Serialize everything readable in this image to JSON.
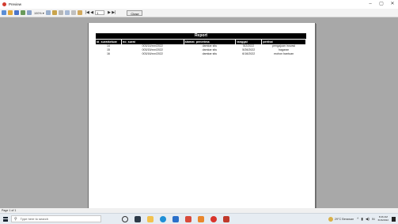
{
  "window": {
    "title": "Preview",
    "controls": {
      "minimize": "–",
      "maximize": "▢",
      "close": "✕"
    }
  },
  "toolbar": {
    "zoom": "100% ▾",
    "page_value": "1",
    "nav_prev": "|◀ ◀",
    "nav_next": "▶ ▶|",
    "close_label": "Close"
  },
  "report": {
    "title": "Report",
    "columns": [
      "id_suratkeluar",
      "no_surat",
      "alamat_penerima",
      "tanggal",
      "perihal"
    ],
    "rows": [
      [
        "14",
        "003/14/xxx/2022",
        "damkar situ",
        "5/2/2022",
        "pengajuan inovasi"
      ],
      [
        "15",
        "003/15/xxx/2022",
        "damkar situ",
        "5/26/2022",
        "hagaran"
      ],
      [
        "16",
        "003/16/xxx/2022",
        "damkar situ",
        "6/16/2022",
        "mohon bantuan"
      ]
    ]
  },
  "status": {
    "page_info": "Page 1 of 1"
  },
  "taskbar": {
    "search_placeholder": "Type here to search",
    "weather": "29°C Berawan",
    "lang": "IN",
    "time": "8:46 AM",
    "date": "6/16/2022"
  },
  "colors": {
    "viewer_bg": "#a8a8a8",
    "header_bg": "#000000",
    "taskbar_bg": "#e6ecf2"
  }
}
